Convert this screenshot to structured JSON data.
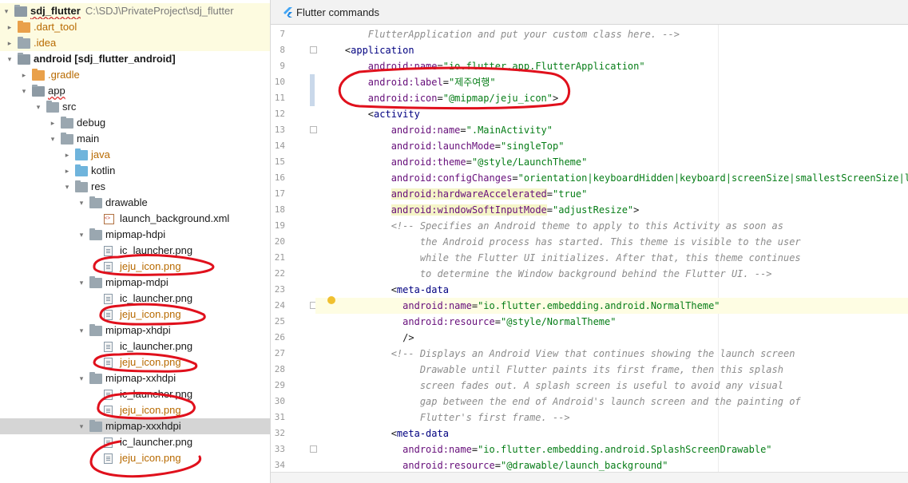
{
  "tree": {
    "root_name": "sdj_flutter",
    "root_path": "C:\\SDJ\\PrivateProject\\sdj_flutter",
    "rows": [
      {
        "arrow": "▸",
        "label": ".dart_tool",
        "type": "folder-orange",
        "color": "orange"
      },
      {
        "arrow": "▸",
        "label": ".idea",
        "type": "folder",
        "color": "orange"
      },
      {
        "arrow": "▾",
        "label": "android [sdj_flutter_android]",
        "type": "folder-mod",
        "color": "bold"
      },
      {
        "arrow": "▸",
        "label": ".gradle",
        "type": "folder-orange",
        "color": "orange"
      },
      {
        "arrow": "▾",
        "label": "app",
        "type": "folder-mod",
        "color": "under"
      },
      {
        "arrow": "▾",
        "label": "src",
        "type": "folder",
        "color": ""
      },
      {
        "arrow": "▸",
        "label": "debug",
        "type": "folder",
        "color": ""
      },
      {
        "arrow": "▾",
        "label": "main",
        "type": "folder",
        "color": ""
      },
      {
        "arrow": "▸",
        "label": "java",
        "type": "folder-blue",
        "color": "orange"
      },
      {
        "arrow": "▸",
        "label": "kotlin",
        "type": "folder-blue",
        "color": ""
      },
      {
        "arrow": "▾",
        "label": "res",
        "type": "folder",
        "color": ""
      },
      {
        "arrow": "▾",
        "label": "drawable",
        "type": "folder",
        "color": ""
      },
      {
        "arrow": "",
        "label": "launch_background.xml",
        "type": "xml",
        "color": ""
      },
      {
        "arrow": "▾",
        "label": "mipmap-hdpi",
        "type": "folder",
        "color": ""
      },
      {
        "arrow": "",
        "label": "ic_launcher.png",
        "type": "file",
        "color": ""
      },
      {
        "arrow": "",
        "label": "jeju_icon.png",
        "type": "file",
        "color": "orange"
      },
      {
        "arrow": "▾",
        "label": "mipmap-mdpi",
        "type": "folder",
        "color": ""
      },
      {
        "arrow": "",
        "label": "ic_launcher.png",
        "type": "file",
        "color": ""
      },
      {
        "arrow": "",
        "label": "jeju_icon.png",
        "type": "file",
        "color": "orange"
      },
      {
        "arrow": "▾",
        "label": "mipmap-xhdpi",
        "type": "folder",
        "color": ""
      },
      {
        "arrow": "",
        "label": "ic_launcher.png",
        "type": "file",
        "color": ""
      },
      {
        "arrow": "",
        "label": "jeju_icon.png",
        "type": "file",
        "color": "orange"
      },
      {
        "arrow": "▾",
        "label": "mipmap-xxhdpi",
        "type": "folder",
        "color": ""
      },
      {
        "arrow": "",
        "label": "ic_launcher.png",
        "type": "file",
        "color": ""
      },
      {
        "arrow": "",
        "label": "jeju_icon.png",
        "type": "file",
        "color": "orange"
      },
      {
        "arrow": "▾",
        "label": "mipmap-xxxhdpi",
        "type": "folder",
        "color": "",
        "selected": true
      },
      {
        "arrow": "",
        "label": "ic_launcher.png",
        "type": "file",
        "color": ""
      },
      {
        "arrow": "",
        "label": "jeju_icon.png",
        "type": "file",
        "color": "orange"
      }
    ]
  },
  "editor": {
    "tab_title": "Flutter commands",
    "lines": [
      {
        "n": "7",
        "parts": [
          [
            "cmt",
            "        FlutterApplication and put your custom class here. -->"
          ]
        ]
      },
      {
        "n": "8",
        "parts": [
          [
            "punct",
            "    <"
          ],
          [
            "tag",
            "application"
          ]
        ]
      },
      {
        "n": "9",
        "parts": [
          [
            "attr",
            "        android:name"
          ],
          [
            "punct",
            "="
          ],
          [
            "val",
            "\"io.flutter.app.FlutterApplication\""
          ]
        ]
      },
      {
        "n": "10",
        "parts": [
          [
            "attr",
            "        android:label"
          ],
          [
            "punct",
            "="
          ],
          [
            "val",
            "\"제주여행\""
          ]
        ]
      },
      {
        "n": "11",
        "parts": [
          [
            "attr",
            "        android:icon"
          ],
          [
            "punct",
            "="
          ],
          [
            "val",
            "\"@mipmap/jeju_icon\""
          ],
          [
            "punct",
            ">"
          ]
        ]
      },
      {
        "n": "12",
        "parts": [
          [
            "punct",
            "        <"
          ],
          [
            "tag",
            "activity"
          ]
        ]
      },
      {
        "n": "13",
        "parts": [
          [
            "attr",
            "            android:name"
          ],
          [
            "punct",
            "="
          ],
          [
            "val",
            "\".MainActivity\""
          ]
        ]
      },
      {
        "n": "14",
        "parts": [
          [
            "attr",
            "            android:launchMode"
          ],
          [
            "punct",
            "="
          ],
          [
            "val",
            "\"singleTop\""
          ]
        ]
      },
      {
        "n": "15",
        "parts": [
          [
            "attr",
            "            android:theme"
          ],
          [
            "punct",
            "="
          ],
          [
            "val",
            "\"@style/LaunchTheme\""
          ]
        ]
      },
      {
        "n": "16",
        "parts": [
          [
            "attr",
            "            android:configChanges"
          ],
          [
            "punct",
            "="
          ],
          [
            "val",
            "\"orientation|keyboardHidden|keyboard|screenSize|smallestScreenSize|loca"
          ]
        ]
      },
      {
        "n": "17",
        "parts": [
          [
            "punct",
            "            "
          ],
          [
            "attr hl",
            "android:hardwareAccelerated"
          ],
          [
            "punct",
            "="
          ],
          [
            "val",
            "\"true\""
          ]
        ]
      },
      {
        "n": "18",
        "parts": [
          [
            "punct",
            "            "
          ],
          [
            "attr hl",
            "android:windowSoftInputMode"
          ],
          [
            "punct",
            "="
          ],
          [
            "val",
            "\"adjustResize\""
          ],
          [
            "punct",
            ">"
          ]
        ]
      },
      {
        "n": "19",
        "parts": [
          [
            "cmt",
            "            <!-- Specifies an Android theme to apply to this Activity as soon as"
          ]
        ]
      },
      {
        "n": "20",
        "parts": [
          [
            "cmt",
            "                 the Android process has started. This theme is visible to the user"
          ]
        ]
      },
      {
        "n": "21",
        "parts": [
          [
            "cmt",
            "                 while the Flutter UI initializes. After that, this theme continues"
          ]
        ]
      },
      {
        "n": "22",
        "parts": [
          [
            "cmt",
            "                 to determine the Window background behind the Flutter UI. -->"
          ]
        ]
      },
      {
        "n": "23",
        "parts": [
          [
            "punct",
            "            <"
          ],
          [
            "tag",
            "meta-data"
          ]
        ]
      },
      {
        "n": "24",
        "parts": [
          [
            "attr",
            "              android:name"
          ],
          [
            "punct",
            "="
          ],
          [
            "val",
            "\"io.flutter.embedding.android.NormalTheme\""
          ]
        ],
        "caret": true
      },
      {
        "n": "25",
        "parts": [
          [
            "attr",
            "              android:resource"
          ],
          [
            "punct",
            "="
          ],
          [
            "val",
            "\"@style/NormalTheme\""
          ]
        ]
      },
      {
        "n": "26",
        "parts": [
          [
            "punct",
            "              />"
          ]
        ]
      },
      {
        "n": "27",
        "parts": [
          [
            "cmt",
            "            <!-- Displays an Android View that continues showing the launch screen"
          ]
        ]
      },
      {
        "n": "28",
        "parts": [
          [
            "cmt",
            "                 Drawable until Flutter paints its first frame, then this splash"
          ]
        ]
      },
      {
        "n": "29",
        "parts": [
          [
            "cmt",
            "                 screen fades out. A splash screen is useful to avoid any visual"
          ]
        ]
      },
      {
        "n": "30",
        "parts": [
          [
            "cmt",
            "                 gap between the end of Android's launch screen and the painting of"
          ]
        ]
      },
      {
        "n": "31",
        "parts": [
          [
            "cmt",
            "                 Flutter's first frame. -->"
          ]
        ]
      },
      {
        "n": "32",
        "parts": [
          [
            "punct",
            "            <"
          ],
          [
            "tag",
            "meta-data"
          ]
        ]
      },
      {
        "n": "33",
        "parts": [
          [
            "attr",
            "              android:name"
          ],
          [
            "punct",
            "="
          ],
          [
            "val",
            "\"io.flutter.embedding.android.SplashScreenDrawable\""
          ]
        ]
      },
      {
        "n": "34",
        "parts": [
          [
            "attr",
            "              android:resource"
          ],
          [
            "punct",
            "="
          ],
          [
            "val",
            "\"@drawable/launch_background\""
          ]
        ]
      }
    ]
  },
  "colors": {
    "annotation": "#e0101c",
    "selection": "#d5d5d5"
  }
}
